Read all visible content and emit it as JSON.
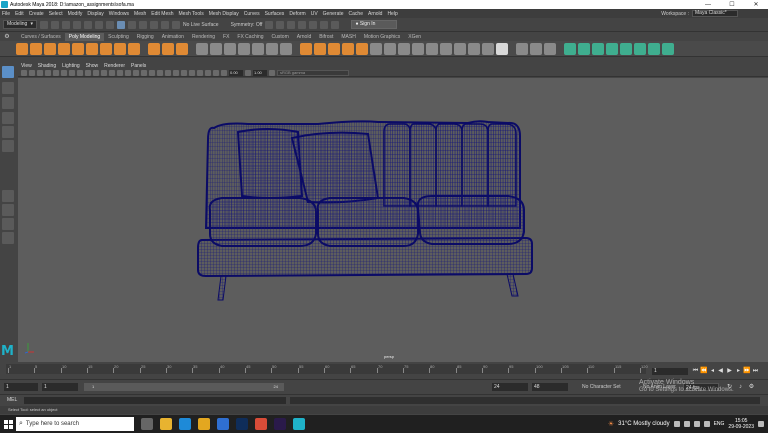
{
  "window": {
    "title": "Autodesk Maya 2018: D:\\amazon_assignments\\sofa.ma",
    "minimize": "—",
    "maximize": "☐",
    "close": "✕"
  },
  "menus": [
    "File",
    "Edit",
    "Create",
    "Select",
    "Modify",
    "Display",
    "Windows",
    "Mesh",
    "Edit Mesh",
    "Mesh Tools",
    "Mesh Display",
    "Curves",
    "Surfaces",
    "Deform",
    "UV",
    "Generate",
    "Cache",
    "Arnold",
    "Help"
  ],
  "workspace": {
    "label": "Workspace :",
    "value": "Maya Classic*"
  },
  "statusline": {
    "mode": "Modeling",
    "live_surface": "No Live Surface",
    "symmetry": "Symmetry: Off",
    "signin": "Sign In"
  },
  "shelf_tabs": [
    "Curves / Surfaces",
    "Poly Modeling",
    "Sculpting",
    "Rigging",
    "Animation",
    "Rendering",
    "FX",
    "FX Caching",
    "Custom",
    "Arnold",
    "Bifrost",
    "MASH",
    "Motion Graphics",
    "XGen"
  ],
  "shelf_active": "Poly Modeling",
  "panel_menu": [
    "View",
    "Shading",
    "Lighting",
    "Show",
    "Renderer",
    "Panels"
  ],
  "panel_fields": {
    "exposure": "0.00",
    "gamma": "1.00",
    "color_space": "sRGB gamma"
  },
  "viewport": {
    "camera": "persp"
  },
  "timeline": {
    "ticks": [
      "1",
      "5",
      "10",
      "15",
      "20",
      "25",
      "30",
      "35",
      "40",
      "45",
      "50",
      "55",
      "60",
      "65",
      "70",
      "75",
      "80",
      "85",
      "90",
      "95",
      "100",
      "105",
      "110",
      "115",
      "120"
    ],
    "current_frame": "1"
  },
  "range": {
    "start": "1",
    "playback_start": "1",
    "bar_start": "1",
    "bar_end": "24",
    "playback_end": "24",
    "end": "48",
    "character_set": "No Character Set",
    "anim_layer": "No Anim Layer",
    "fps": "24 fps"
  },
  "activate": {
    "line1": "Activate Windows",
    "line2": "Go to Settings to activate Windows."
  },
  "cmdline": {
    "lang": "MEL"
  },
  "helpline": "Select Tool: select an object",
  "taskbar": {
    "search_placeholder": "Type here to search",
    "weather": "31°C  Mostly cloudy",
    "lang": "ENG",
    "time": "15:05",
    "date": "29-09-2023"
  }
}
